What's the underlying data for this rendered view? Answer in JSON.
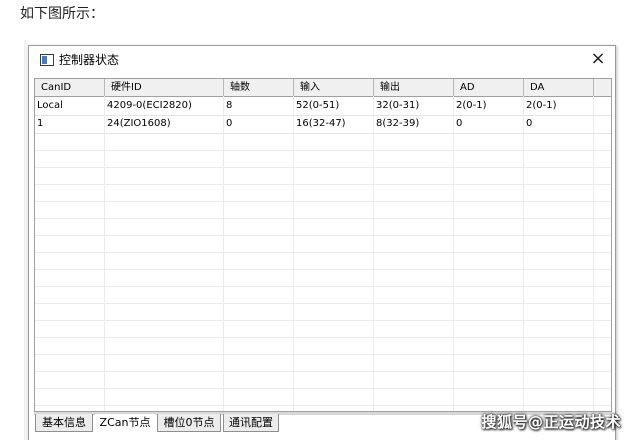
{
  "caption": "如下图所示：",
  "window": {
    "title": "控制器状态",
    "close_label": "×",
    "icon": "app-window-icon"
  },
  "table": {
    "columns": [
      "CanID",
      "硬件ID",
      "轴数",
      "输入",
      "输出",
      "AD",
      "DA"
    ],
    "rows": [
      [
        "Local",
        "4209-0(ECI2820)",
        "8",
        "52(0-51)",
        "32(0-31)",
        "2(0-1)",
        "2(0-1)"
      ],
      [
        "1",
        "24(ZIO1608)",
        "0",
        "16(32-47)",
        "8(32-39)",
        "0",
        "0"
      ]
    ]
  },
  "tabs": [
    {
      "label": "基本信息",
      "active": false
    },
    {
      "label": "ZCan节点",
      "active": true
    },
    {
      "label": "槽位0节点",
      "active": false
    },
    {
      "label": "通讯配置",
      "active": false
    }
  ],
  "watermark": "搜狐号@正运动技术"
}
